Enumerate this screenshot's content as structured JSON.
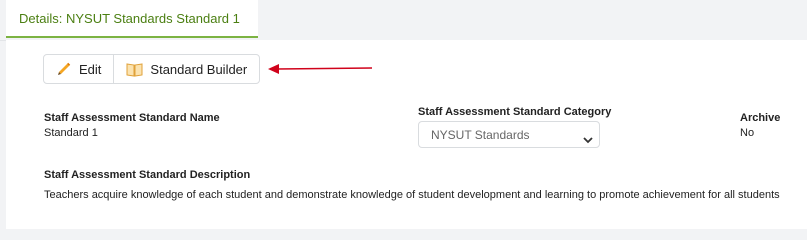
{
  "tab": {
    "label": "Details: NYSUT Standards Standard 1"
  },
  "toolbar": {
    "edit_label": "Edit",
    "builder_label": "Standard Builder"
  },
  "fields": {
    "name": {
      "label": "Staff Assessment Standard Name",
      "value": "Standard 1"
    },
    "category": {
      "label": "Staff Assessment Standard Category",
      "selected": "NYSUT Standards"
    },
    "archive": {
      "label": "Archive",
      "value": "No"
    },
    "description": {
      "label": "Staff Assessment Standard Description",
      "value": "Teachers acquire knowledge of each student and demonstrate knowledge of student development and learning to promote achievement for all students"
    }
  },
  "colors": {
    "accent": "#7cb342",
    "tab_text": "#4b7f12",
    "annotation_arrow": "#d0021b",
    "edit_icon": "#f5a623"
  },
  "icons": {
    "edit": "pencil-icon",
    "builder": "book-icon",
    "select": "chevron-down-icon",
    "annotation": "red-arrow-icon"
  }
}
